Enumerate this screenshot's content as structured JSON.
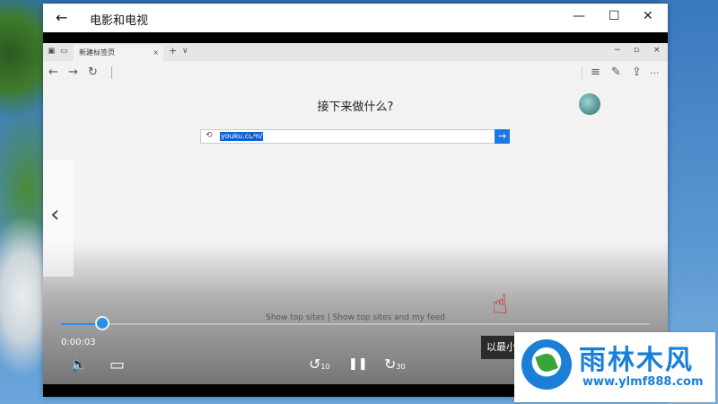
{
  "app": {
    "title": "电影和电视",
    "back_glyph": "←",
    "minimize_glyph": "—",
    "maximize_glyph": "☐",
    "close_glyph": "✕"
  },
  "browser": {
    "tab_title": "新建标签页",
    "tab_close": "×",
    "new_tab": "+",
    "tab_menu": "∨",
    "nav": {
      "back": "←",
      "forward": "→",
      "refresh": "↻",
      "hub": "≡",
      "notes": "✎",
      "share": "⇪",
      "more": "···"
    },
    "window_controls": {
      "minimize": "−",
      "restore": "▫",
      "close": "×"
    }
  },
  "newtab": {
    "prompt": "接下来做什么?",
    "search": {
      "history_glyph": "⟲",
      "value": "youku.com/",
      "go_glyph": "→"
    },
    "top_sites": "Show top sites | Show top sites and my feed"
  },
  "player": {
    "previous_glyph": "‹",
    "progress": 0.07,
    "current_time": "0:00:03",
    "volume_glyph": "🔈",
    "subtitles_glyph": "▭",
    "rewind_glyph": "↺",
    "rewind_seconds": "10",
    "pause_glyph": "❚❚",
    "forward_glyph": "↻",
    "forward_seconds": "30",
    "tooltip": "以最小"
  },
  "watermark": {
    "name": "雨林木风",
    "url": "www.ylmf888.com"
  },
  "colors": {
    "accent": "#2a8fe8",
    "selection": "#0b63d6",
    "logo": "#1b7fd8"
  }
}
